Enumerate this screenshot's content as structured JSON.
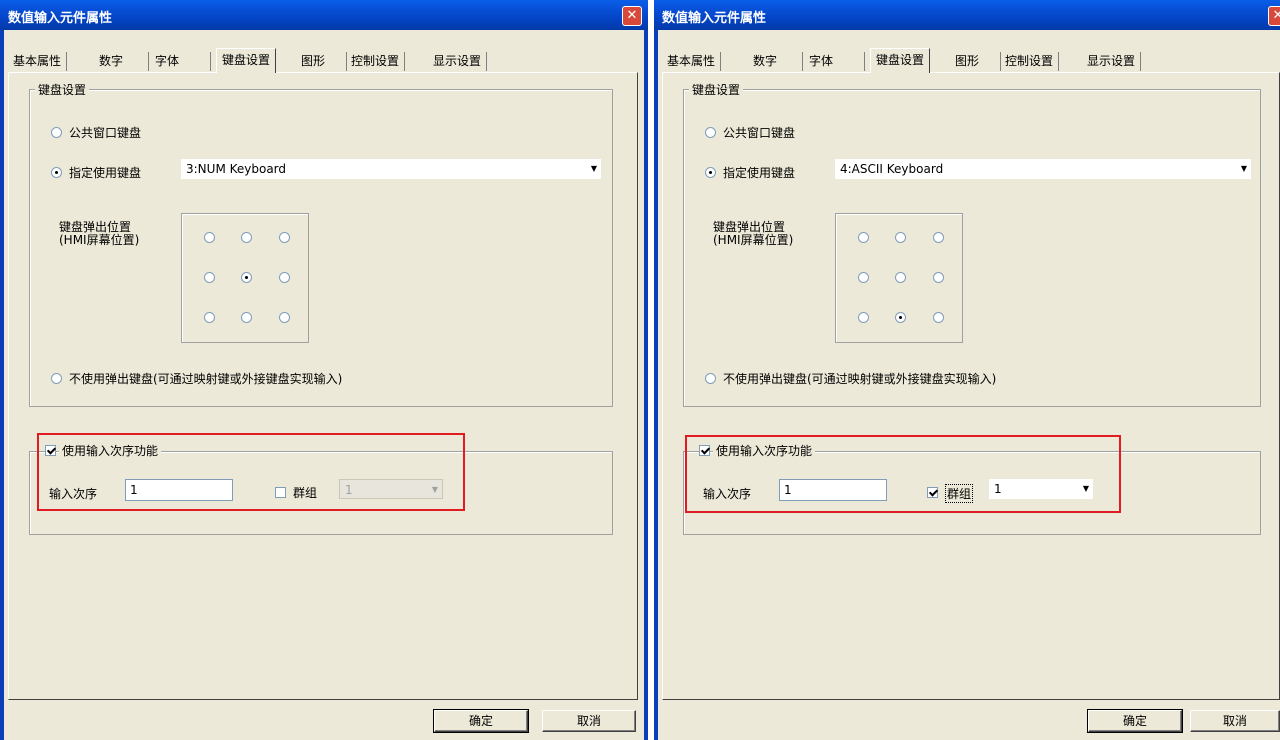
{
  "colors": {
    "highlight": "#e11b22",
    "title_bar": "#0a4fd8",
    "dialog_bg": "#ece9d8"
  },
  "dialogs": [
    {
      "title": "数值输入元件属性",
      "close_icon": "close-icon",
      "tabs": [
        "基本属性",
        "数字",
        "字体",
        "键盘设置",
        "图形",
        "控制设置",
        "显示设置"
      ],
      "active_tab": "键盘设置",
      "group_keyboard": "键盘设置",
      "radio_public": "公共窗口键盘",
      "radio_specified": "指定使用键盘",
      "keyboard_select": "3:NUM Keyboard",
      "popup_label": "键盘弹出位置\n(HMI屏幕位置)",
      "popup_selected": "middle-center",
      "radio_no_popup": "不使用弹出键盘(可通过映射键或外接键盘实现输入)",
      "input_order_check": "使用输入次序功能",
      "input_order_checked": true,
      "input_order_label": "输入次序",
      "input_order_value": "1",
      "group_check": "群组",
      "group_checked": false,
      "group_value": "1",
      "ok": "确定",
      "cancel": "取消"
    },
    {
      "title": "数值输入元件属性",
      "close_icon": "close-icon",
      "tabs": [
        "基本属性",
        "数字",
        "字体",
        "键盘设置",
        "图形",
        "控制设置",
        "显示设置"
      ],
      "active_tab": "键盘设置",
      "group_keyboard": "键盘设置",
      "radio_public": "公共窗口键盘",
      "radio_specified": "指定使用键盘",
      "keyboard_select": "4:ASCII Keyboard",
      "popup_label": "键盘弹出位置\n(HMI屏幕位置)",
      "popup_selected": "bottom-center",
      "radio_no_popup": "不使用弹出键盘(可通过映射键或外接键盘实现输入)",
      "input_order_check": "使用输入次序功能",
      "input_order_checked": true,
      "input_order_label": "输入次序",
      "input_order_value": "1",
      "group_check": "群组",
      "group_checked": true,
      "group_value": "1",
      "ok": "确定",
      "cancel": "取消"
    }
  ]
}
